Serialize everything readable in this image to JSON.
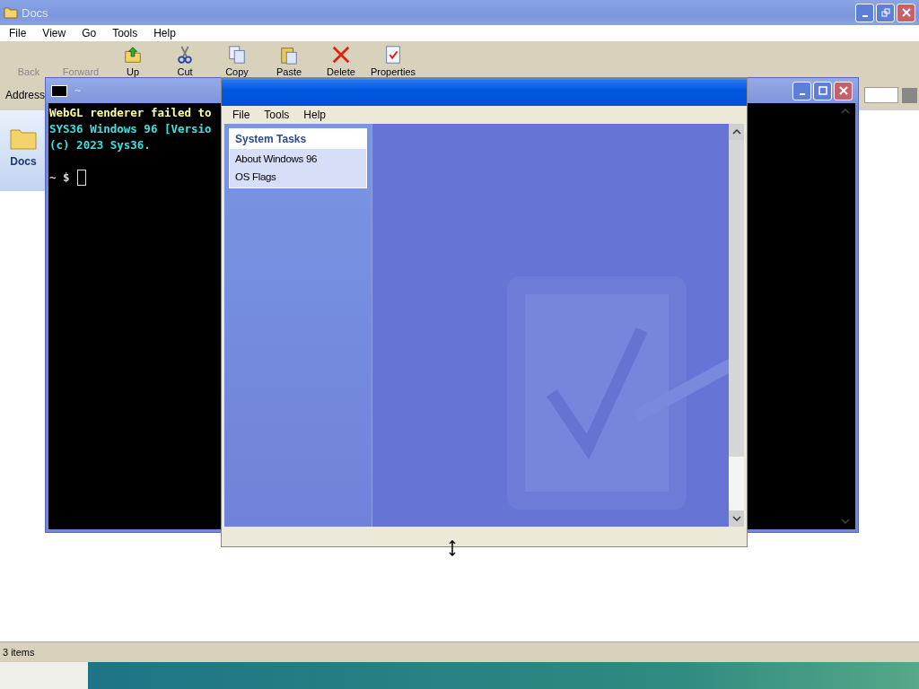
{
  "explorer": {
    "title": "Docs",
    "menu": [
      "File",
      "View",
      "Go",
      "Tools",
      "Help"
    ],
    "toolbar": [
      {
        "label": "Back",
        "kind": "nav",
        "disabled": true
      },
      {
        "label": "Forward",
        "kind": "nav",
        "disabled": true
      },
      {
        "label": "Up",
        "kind": "up",
        "disabled": false
      },
      {
        "label": "Cut",
        "kind": "cut",
        "disabled": false
      },
      {
        "label": "Copy",
        "kind": "copy",
        "disabled": false
      },
      {
        "label": "Paste",
        "kind": "paste",
        "disabled": false
      },
      {
        "label": "Delete",
        "kind": "delete",
        "disabled": false
      },
      {
        "label": "Properties",
        "kind": "properties",
        "disabled": false
      }
    ],
    "address_label": "Address",
    "side_item": "Docs",
    "status": "3 items"
  },
  "terminal": {
    "title": "~",
    "lines": [
      {
        "text": "WebGL renderer failed to",
        "color": "#ffffa0"
      },
      {
        "text": "SYS36 Windows 96 [Versio",
        "color": "#40e0e0"
      },
      {
        "text": "(c) 2023 Sys36.",
        "color": "#40e0e0"
      }
    ],
    "prompt": "~ $"
  },
  "control_panel": {
    "menu": [
      "File",
      "Tools",
      "Help"
    ],
    "task_title": "System Tasks",
    "tasks": [
      "About Windows 96",
      "OS Flags"
    ]
  }
}
